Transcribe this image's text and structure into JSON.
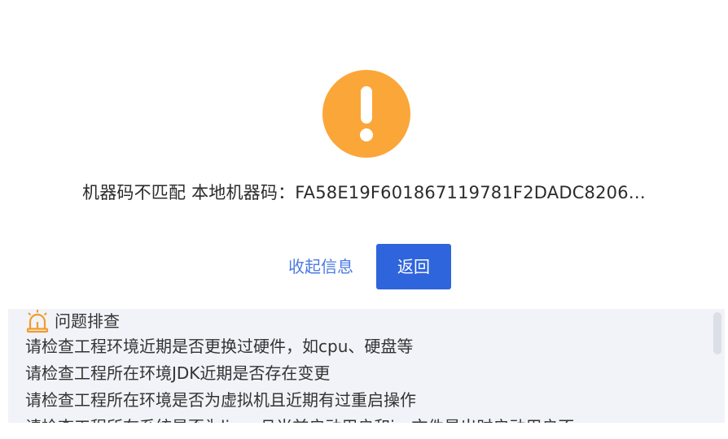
{
  "error": {
    "icon": "exclamation-circle-icon",
    "icon_color": "#fba638",
    "message": "机器码不匹配 本地机器码：FA58E19F601867119781F2DADC8206…"
  },
  "actions": {
    "collapse_label": "收起信息",
    "back_label": "返回",
    "primary_color": "#2f65dc",
    "link_color": "#4c7be0"
  },
  "troubleshoot": {
    "icon": "alarm-light-icon",
    "title": "问题排查",
    "items": [
      "请检查工程环境近期是否更换过硬件，如cpu、硬盘等",
      "请检查工程所在环境JDK近期是否存在变更",
      "请检查工程所在环境是否为虚拟机且近期有过重启操作",
      "请检查工程所在系统是否为linux且当前启动用户和jar文件是出时启动用户不"
    ]
  }
}
